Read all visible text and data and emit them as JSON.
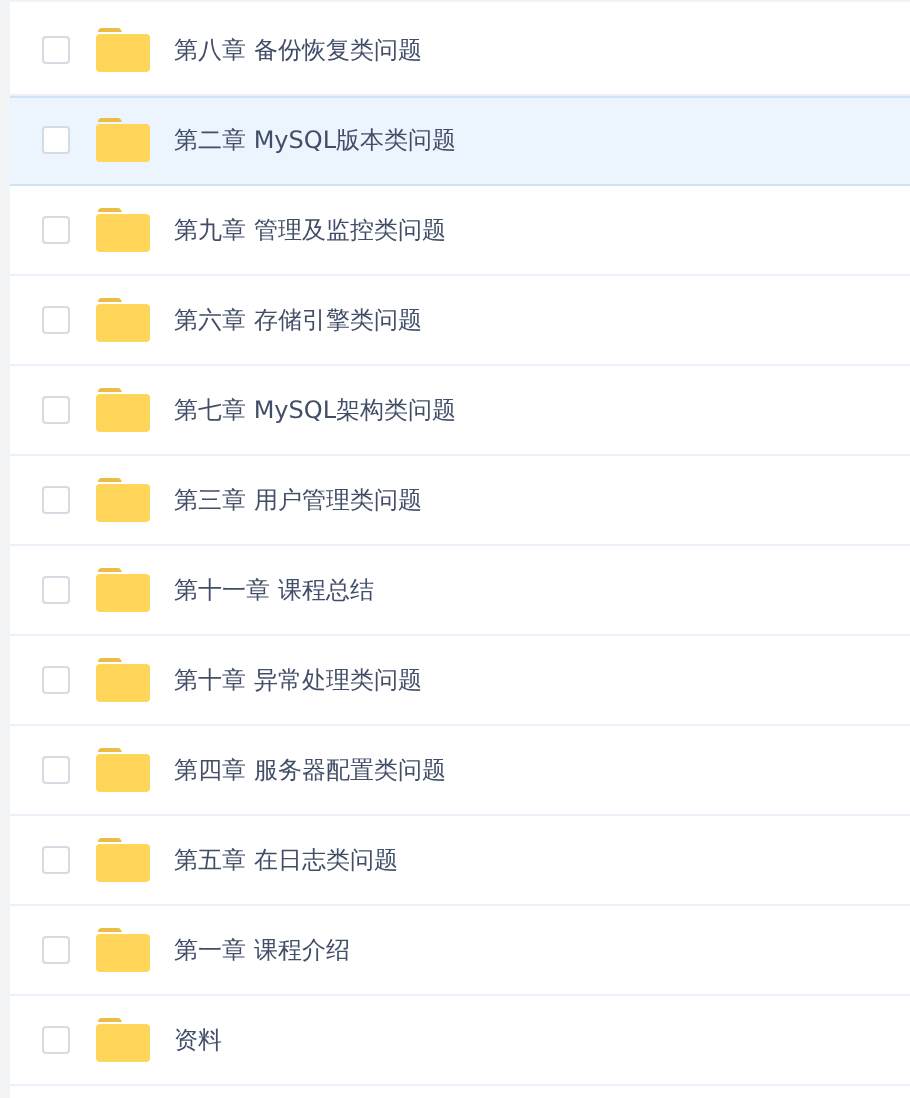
{
  "files": [
    {
      "name": "第八章 备份恢复类问题",
      "selected": false
    },
    {
      "name": "第二章 MySQL版本类问题",
      "selected": true
    },
    {
      "name": "第九章 管理及监控类问题",
      "selected": false
    },
    {
      "name": "第六章 存储引擎类问题",
      "selected": false
    },
    {
      "name": "第七章 MySQL架构类问题",
      "selected": false
    },
    {
      "name": "第三章 用户管理类问题",
      "selected": false
    },
    {
      "name": "第十一章 课程总结",
      "selected": false
    },
    {
      "name": "第十章 异常处理类问题",
      "selected": false
    },
    {
      "name": "第四章 服务器配置类问题",
      "selected": false
    },
    {
      "name": "第五章 在日志类问题",
      "selected": false
    },
    {
      "name": "第一章 课程介绍",
      "selected": false
    },
    {
      "name": "资料",
      "selected": false
    }
  ]
}
